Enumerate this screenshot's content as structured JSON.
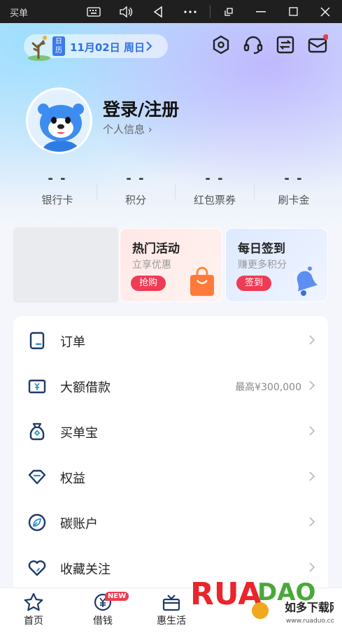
{
  "titlebar": {
    "app_name": "买单",
    "buttons": [
      "keyboard-icon",
      "volume-icon",
      "back-icon",
      "more-icon",
      "restore-icon",
      "minimize-icon",
      "maximize-icon",
      "close-icon"
    ]
  },
  "header": {
    "calendar_tag": "日历",
    "date_text": "11月02日 周日"
  },
  "profile": {
    "login_title": "登录/注册",
    "profile_link": "个人信息 ›"
  },
  "stats": [
    {
      "value": "- -",
      "label": "银行卡"
    },
    {
      "value": "- -",
      "label": "积分"
    },
    {
      "value": "- -",
      "label": "红包票券"
    },
    {
      "value": "- -",
      "label": "刷卡金"
    }
  ],
  "promos": [
    {
      "title": "热门活动",
      "subtitle": "立享优惠",
      "button": "抢购"
    },
    {
      "title": "每日签到",
      "subtitle": "赚更多积分",
      "button": "签到"
    }
  ],
  "menu": [
    {
      "label": "订单",
      "extra": "",
      "icon": "order-icon"
    },
    {
      "label": "大额借款",
      "extra": "最高¥300,000",
      "icon": "loan-icon"
    },
    {
      "label": "买单宝",
      "extra": "",
      "icon": "money-bag-icon"
    },
    {
      "label": "权益",
      "extra": "",
      "icon": "diamond-icon"
    },
    {
      "label": "碳账户",
      "extra": "",
      "icon": "carbon-leaf-icon"
    },
    {
      "label": "收藏关注",
      "extra": "",
      "icon": "heart-icon"
    }
  ],
  "bottom_nav": [
    {
      "label": "首页",
      "icon": "star-icon"
    },
    {
      "label": "借钱",
      "icon": "yen-coin-icon",
      "badge": "NEW"
    },
    {
      "label": "惠生活",
      "icon": "gift-box-icon"
    }
  ],
  "watermark": {
    "logo": "RUANDAO",
    "cn": "如多下载网",
    "url": "www.ruaduo.com"
  },
  "colors": {
    "accent_blue": "#2f6fe0",
    "promo_red": "#ef3b53",
    "badge_red": "#ef3b53"
  }
}
